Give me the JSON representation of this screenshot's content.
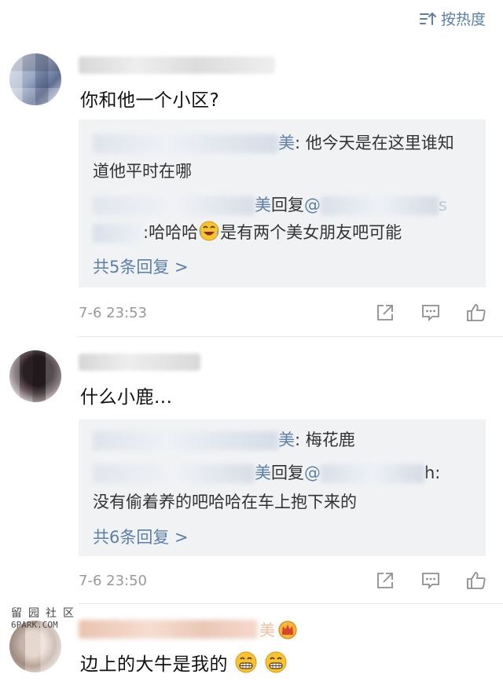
{
  "sort": {
    "label": "按热度"
  },
  "comments": [
    {
      "text": "你和他一个小区?",
      "replies": [
        {
          "suffix": "美",
          "text": ": 他今天是在这里谁知",
          "text2": "道他平时在哪"
        },
        {
          "suffix": "美",
          "verb": "回复",
          "at": "@",
          "tail": "s",
          "text": ":哈哈哈",
          "text2": "是有两个美女朋友吧可能"
        }
      ],
      "more": "共5条回复 >",
      "time": "7-6 23:53"
    },
    {
      "text": "什么小鹿...",
      "replies": [
        {
          "suffix": "美",
          "text": ": 梅花鹿"
        },
        {
          "suffix": "美",
          "verb": "回复",
          "at": "@",
          "tail": "h:",
          "text": "没有偷着养的吧哈哈在车上抱下来的"
        }
      ],
      "more": "共6条回复 >",
      "time": "7-6 23:50"
    },
    {
      "name_suffix": "美",
      "text": "边上的大牛是我的"
    }
  ],
  "watermark": {
    "cn": "留园社区",
    "en": "6PARK.COM"
  },
  "colors": {
    "link": "#5b7fa8",
    "meta": "#999999",
    "reply_bg": "#f1f2f4"
  },
  "icons": [
    "sort-icon",
    "share-icon",
    "comment-icon",
    "like-icon",
    "laugh-cry-emoji",
    "grin-emoji",
    "crown-badge-icon"
  ]
}
